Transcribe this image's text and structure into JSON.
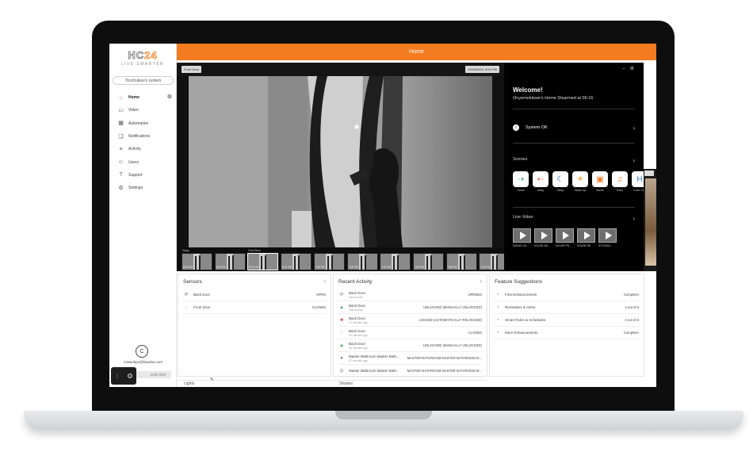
{
  "logo": {
    "main_a": "HC",
    "main_b": "24",
    "tagline": "LIVE SMARTER"
  },
  "system_name": "Toochukwu's system",
  "nav": [
    {
      "label": "Home",
      "icon": "home-icon",
      "glyph": "⌂",
      "active": true
    },
    {
      "label": "Video",
      "icon": "video-icon",
      "glyph": "▭",
      "active": false
    },
    {
      "label": "Automation",
      "icon": "automation-icon",
      "glyph": "▦",
      "active": false
    },
    {
      "label": "Notifications",
      "icon": "notifications-icon",
      "glyph": "❏",
      "active": false
    },
    {
      "label": "Activity",
      "icon": "activity-icon",
      "glyph": "≡",
      "active": false
    },
    {
      "label": "Users",
      "icon": "users-icon",
      "glyph": "☺",
      "active": false
    },
    {
      "label": "Support",
      "icon": "support-icon",
      "glyph": "?",
      "active": false
    },
    {
      "label": "Settings",
      "icon": "settings-icon",
      "glyph": "⚙",
      "active": false
    }
  ],
  "user": {
    "initial": "C",
    "email": "cnwankpo@hauxba.com",
    "logout": "LOG OUT"
  },
  "header": {
    "title": "Home"
  },
  "video": {
    "badge_left": "Front Door",
    "badge_right": "10/28/2022, 8:04 PM",
    "thumbnails": [
      {
        "time": "8:04 PM",
        "top": "Today"
      },
      {
        "time": "8:03 PM",
        "top": ""
      },
      {
        "time": "8:02 PM",
        "top": "Front Door"
      },
      {
        "time": "8:01 PM",
        "top": ""
      },
      {
        "time": "7:59 PM",
        "top": ""
      },
      {
        "time": "7:58 PM",
        "top": ""
      },
      {
        "time": "7:57 PM",
        "top": ""
      },
      {
        "time": "7:56 PM",
        "top": ""
      },
      {
        "time": "7:55 PM",
        "top": ""
      },
      {
        "time": "7:54 PM",
        "top": ""
      }
    ]
  },
  "welcome": {
    "title": "Welcome!",
    "subtitle": "Onyemelukwe's Home Disarmed at 06:16",
    "system_status": "System OK",
    "scenes_label": "Scenes",
    "scenes": [
      {
        "label": "Home",
        "icon": "home-scene-icon",
        "glyph": "⇢",
        "color": "#2e9a58"
      },
      {
        "label": "Away",
        "icon": "away-scene-icon",
        "glyph": "⇠",
        "color": "#e0553a"
      },
      {
        "label": "Sleep",
        "icon": "sleep-scene-icon",
        "glyph": "☾",
        "color": "#2a5db0"
      },
      {
        "label": "Wake Up",
        "icon": "wake-up-scene-icon",
        "glyph": "☀",
        "color": "#f0a020"
      },
      {
        "label": "Movie",
        "icon": "movie-scene-icon",
        "glyph": "▣",
        "color": "#f07a20"
      },
      {
        "label": "Party",
        "icon": "party-scene-icon",
        "glyph": "♫",
        "color": "#f07a20"
      },
      {
        "label": "Color Cue",
        "icon": "color-cue-scene-icon",
        "glyph": "H",
        "color": "#3a7bd5"
      }
    ],
    "live_label": "Live Video",
    "live_videos": [
      "DINING GU...",
      "HOUSE BA...",
      "HOUSE FR...",
      "HOUSE RE...",
      "KITCHEN..."
    ]
  },
  "sensors": {
    "title": "Sensors",
    "rows": [
      {
        "name": "Back Door",
        "value": "OPEN",
        "icon": "door-open-icon",
        "glyph": "⟳"
      },
      {
        "name": "Front Door",
        "value": "CLOSED",
        "icon": "door-closed-icon",
        "glyph": "◌"
      }
    ]
  },
  "recent_activity": {
    "title": "Recent Activity",
    "rows": [
      {
        "name": "Back Door",
        "sub": "less minute",
        "value": "OPENED",
        "icon": "sensor-open-icon",
        "glyph": "⟳",
        "tone": ""
      },
      {
        "name": "Back Door",
        "sub": "less minute",
        "value": "UNLOCKED (MANUALLY UNLOCKED)",
        "icon": "unlock-icon",
        "glyph": "▲",
        "tone": "grn"
      },
      {
        "name": "Back Door",
        "sub": "21 minutes ago",
        "value": "LOCKED (AUTOMATICALLY RELOCKED)",
        "icon": "lock-icon",
        "glyph": "■",
        "tone": "red"
      },
      {
        "name": "Back Door",
        "sub": "22 minutes ago",
        "value": "CLOSED",
        "icon": "sensor-closed-icon",
        "glyph": "◌",
        "tone": ""
      },
      {
        "name": "Back Door",
        "sub": "28 minutes ago",
        "value": "UNLOCKED (MANUALLY UNLOCKED)",
        "icon": "unlock-icon",
        "glyph": "▲",
        "tone": "grn"
      },
      {
        "name": "Master Bathroom Master Bath...",
        "sub": "37 minutes ago",
        "value": "MASTER BATHROOM MASTER BATHROOM M...",
        "icon": "light-icon",
        "glyph": "●",
        "tone": ""
      },
      {
        "name": "Master Bathroom Master Bath...",
        "sub": "",
        "value": "MASTER BATHROOM MASTER BATHROOM M...",
        "icon": "light-icon",
        "glyph": "◎",
        "tone": ""
      }
    ]
  },
  "feature_suggestions": {
    "title": "Feature Suggestions",
    "rows": [
      {
        "name": "First Enhancements",
        "value": "Complete!",
        "icon": "enhancement-icon",
        "glyph": "◔"
      },
      {
        "name": "Reminders & Alerts",
        "value": "4 out of 8",
        "icon": "reminder-icon",
        "glyph": "◔"
      },
      {
        "name": "Smart Rules & Schedules",
        "value": "4 out of 8",
        "icon": "rules-icon",
        "glyph": "◔"
      },
      {
        "name": "More Enhancements",
        "value": "Complete!",
        "icon": "more-enhancement-icon",
        "glyph": "◔"
      }
    ]
  },
  "bottom": {
    "lights": "Lights",
    "shades": "Shades"
  },
  "colors": {
    "accent": "#f47c20"
  }
}
